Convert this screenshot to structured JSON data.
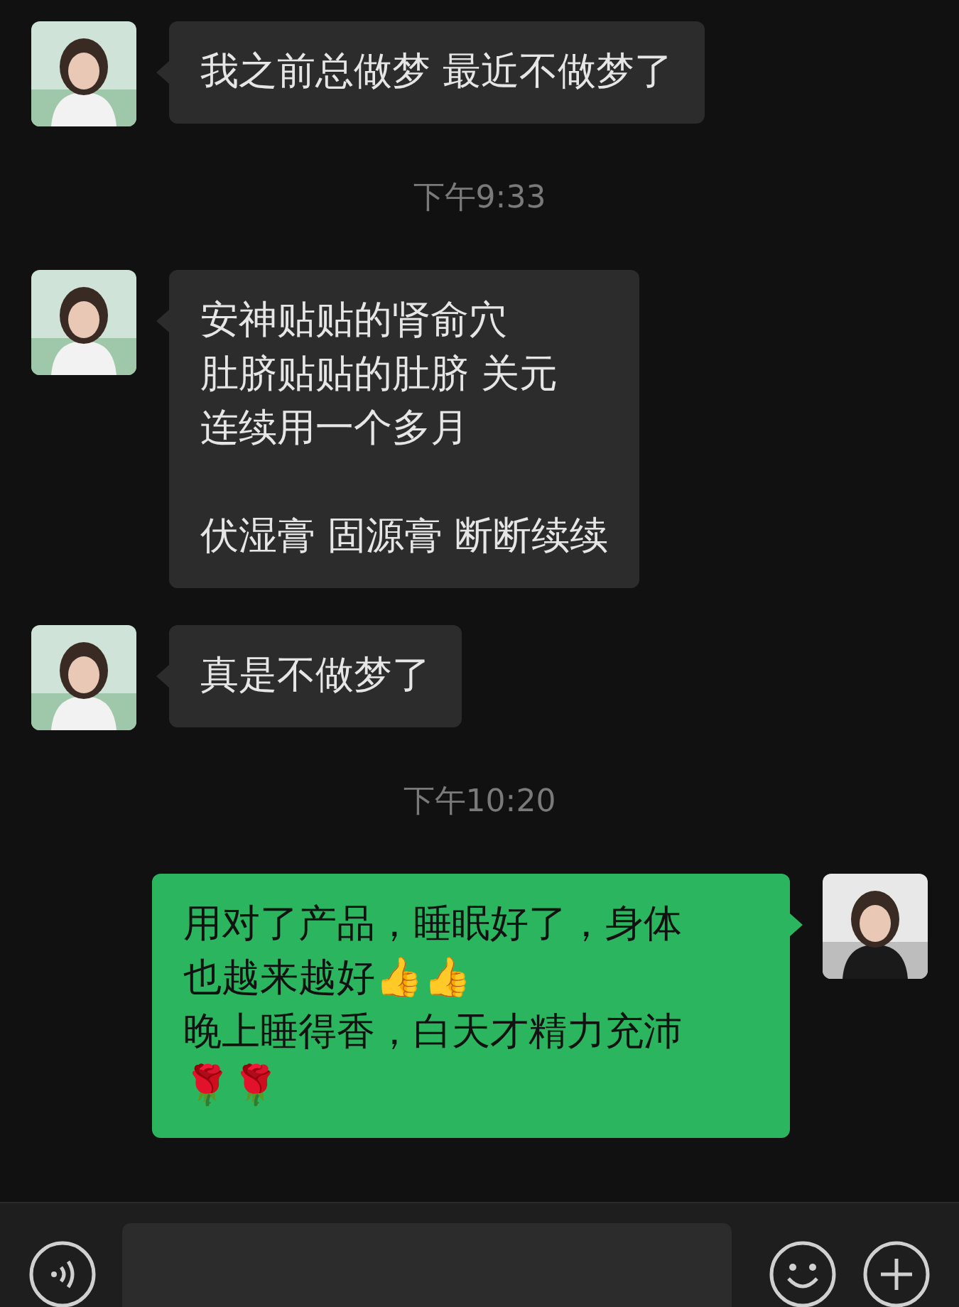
{
  "messages": [
    {
      "kind": "received",
      "paragraphs": [
        [
          "我之前总做梦 最近不做梦了"
        ]
      ]
    },
    {
      "kind": "time",
      "text": "下午9:33"
    },
    {
      "kind": "received",
      "paragraphs": [
        [
          "安神贴贴的肾俞穴",
          "肚脐贴贴的肚脐 关元",
          "连续用一个多月"
        ],
        [
          "伏湿膏 固源膏 断断续续"
        ]
      ]
    },
    {
      "kind": "received",
      "paragraphs": [
        [
          "真是不做梦了"
        ]
      ]
    },
    {
      "kind": "time",
      "text": "下午10:20"
    },
    {
      "kind": "sent",
      "paragraphs": [
        [
          "用对了产品，睡眠好了，身体也越来越好👍👍",
          "晚上睡得香，白天才精力充沛🌹🌹"
        ]
      ]
    }
  ]
}
